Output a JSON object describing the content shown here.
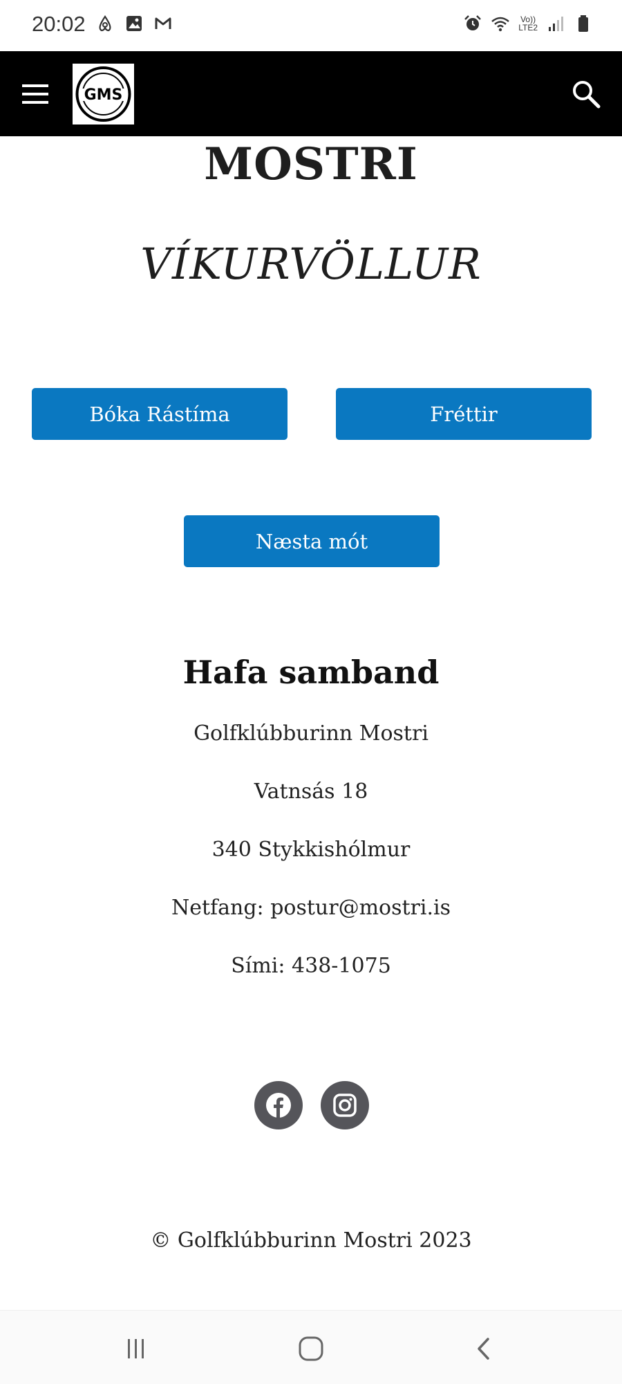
{
  "status_bar": {
    "time": "20:02",
    "network_label": "LTE2",
    "icons_left": [
      "airbnb-icon",
      "gallery-icon",
      "gmail-icon"
    ],
    "icons_right": [
      "alarm-icon",
      "wifi-icon",
      "volte-icon",
      "signal-icon",
      "battery-icon"
    ]
  },
  "header": {
    "logo_alt": "GMS",
    "menu_icon": "hamburger-menu-icon",
    "search_icon": "search-icon",
    "background": "#000000"
  },
  "hero": {
    "title": "MOSTRI",
    "subtitle": "VÍKURVÖLLUR"
  },
  "buttons": {
    "book_tee_time": "Bóka Rástíma",
    "news": "Fréttir",
    "next_tournament": "Næsta mót",
    "color": "#0a78c1"
  },
  "contact": {
    "heading": "Hafa samband",
    "club_name": "Golfklúbburinn Mostri",
    "street": "Vatnsás 18",
    "city": "340 Stykkishólmur",
    "email": "Netfang: postur@mostri.is",
    "phone": "Sími: 438-1075"
  },
  "social": {
    "items": [
      "facebook-icon",
      "instagram-icon"
    ],
    "color": "#55555a"
  },
  "footer": {
    "copyright": "© Golfklúbburinn Mostri 2023"
  },
  "system_nav": [
    "recents-icon",
    "home-icon",
    "back-icon"
  ]
}
